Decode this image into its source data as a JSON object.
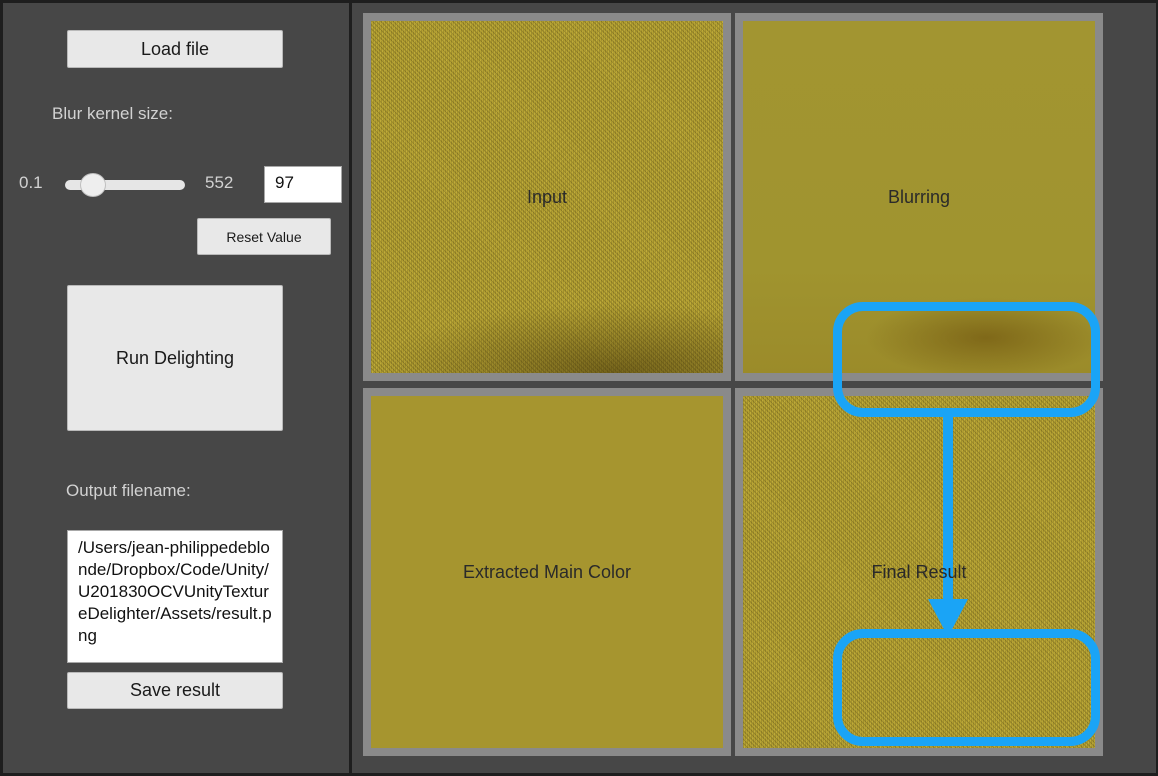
{
  "toolbar": {
    "load_label": "Load file"
  },
  "blur": {
    "label": "Blur kernel size:",
    "min_label": "0.1",
    "max_label": "552",
    "value": "97",
    "slider_fraction": 0.18,
    "reset_label": "Reset Value"
  },
  "run": {
    "label": "Run Delighting"
  },
  "output": {
    "label": "Output filename:",
    "value": "/Users/jean-philippedeblonde/Dropbox/Code/Unity/U201830OCVUnityTextureDelighter/Assets/result.png",
    "save_label": "Save result"
  },
  "tiles": {
    "input": "Input",
    "blurring": "Blurring",
    "extracted": "Extracted Main Color",
    "final": "Final Result"
  },
  "colors": {
    "highlight": "#1aa4f6",
    "panel": "#474747",
    "texture": "#b6a232"
  }
}
